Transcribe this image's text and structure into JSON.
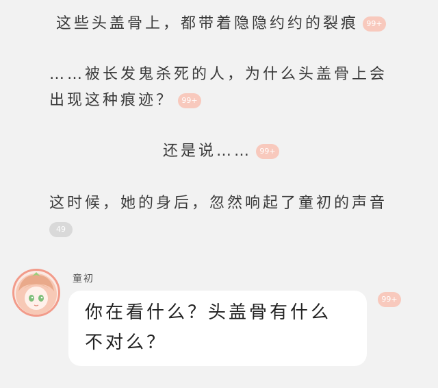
{
  "paragraphs": [
    {
      "text": "这些头盖骨上，都带着隐隐约约的裂痕",
      "badge": "99+"
    },
    {
      "text": "……被长发鬼杀死的人，为什么头盖骨上会",
      "text2": "出现这种痕迹？",
      "badge": "99+"
    },
    {
      "text": "还是说……",
      "badge": "99+"
    },
    {
      "text": "这时候，她的身后，忽然响起了童初的声音",
      "badge": "49"
    }
  ],
  "dialog": {
    "speaker": "童初",
    "message": "你在看什么？头盖骨有什么不对么？",
    "badge": "99+",
    "avatar_icon": "anime-girl-avatar-icon"
  },
  "colors": {
    "background": "#f2f2f2",
    "badge_pink": "#f8c9bd",
    "badge_gray": "#d9d9d9",
    "avatar_border": "#f29b8a",
    "bubble": "#ffffff"
  }
}
